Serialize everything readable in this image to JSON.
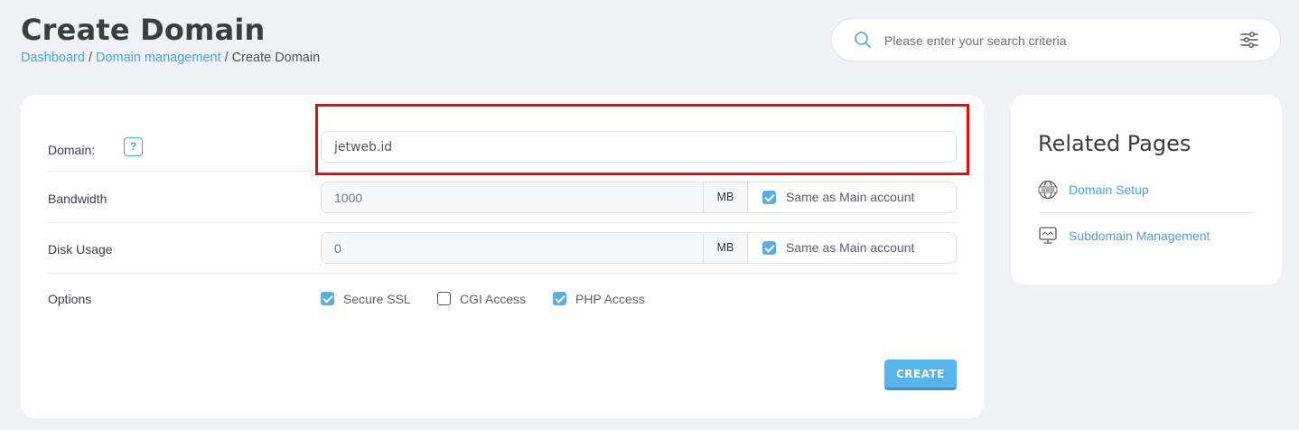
{
  "header": {
    "title": "Create Domain",
    "breadcrumb": {
      "dashboard": "Dashboard",
      "sep1": "/",
      "domain_management": "Domain management",
      "sep2": "/",
      "current": "Create Domain"
    }
  },
  "search": {
    "placeholder": "Please enter your search criteria",
    "icon": "search-icon",
    "filter_icon": "sliders-icon"
  },
  "form": {
    "domain": {
      "label": "Domain:",
      "help": "?",
      "value": "jetweb.id"
    },
    "bandwidth": {
      "label": "Bandwidth",
      "value": "1000",
      "unit": "MB",
      "same_label": "Same as Main account",
      "same_checked": true
    },
    "disk_usage": {
      "label": "Disk Usage",
      "value": "0",
      "unit": "MB",
      "same_label": "Same as Main account",
      "same_checked": true
    },
    "options": {
      "label": "Options",
      "items": [
        {
          "label": "Secure SSL",
          "checked": true
        },
        {
          "label": "CGI Access",
          "checked": false
        },
        {
          "label": "PHP Access",
          "checked": true
        }
      ]
    },
    "create_label": "CREATE"
  },
  "related": {
    "title": "Related Pages",
    "items": [
      {
        "label": "Domain Setup",
        "icon": "www-globe-icon"
      },
      {
        "label": "Subdomain Management",
        "icon": "monitor-icon"
      }
    ]
  },
  "colors": {
    "accent": "#4aa3df",
    "button": "#5ab4ec",
    "highlight": "#e01010",
    "background": "#f0f1f6"
  }
}
